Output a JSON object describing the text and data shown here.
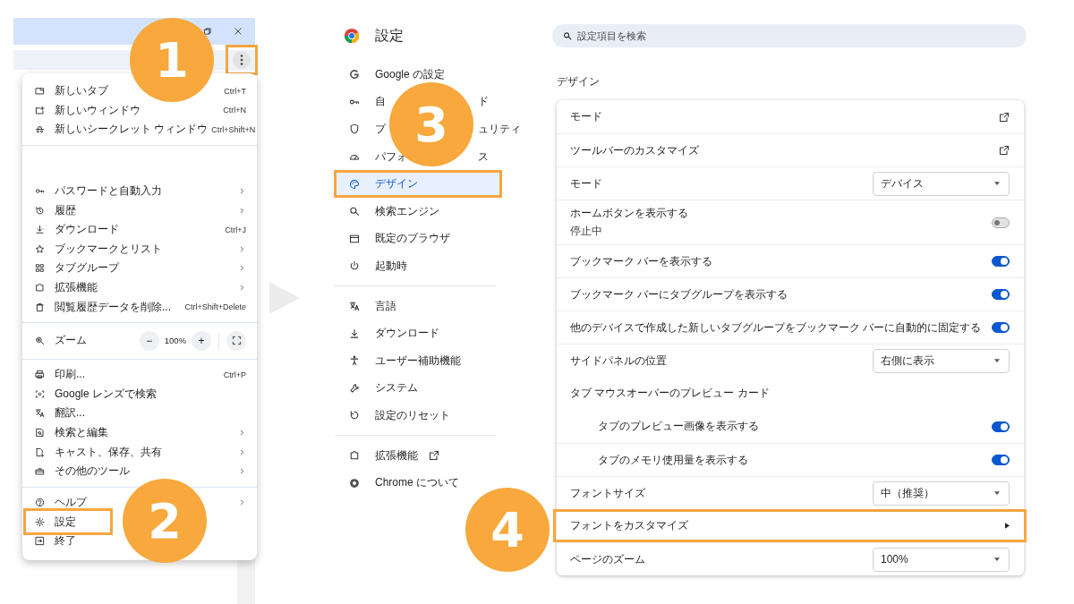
{
  "browser_menu": {
    "items": [
      {
        "kind": "item",
        "label": "新しいタブ",
        "shortcut": "Ctrl+T",
        "highlighted": false
      },
      {
        "kind": "item",
        "label": "新しいウィンドウ",
        "shortcut": "Ctrl+N",
        "highlighted": false
      },
      {
        "kind": "item",
        "label": "新しいシークレット ウィンドウ",
        "shortcut": "Ctrl+Shift+N",
        "highlighted": false
      },
      {
        "kind": "divider"
      },
      {
        "kind": "blank"
      },
      {
        "kind": "item",
        "label": "パスワードと自動入力",
        "submenu": true,
        "highlighted": false
      },
      {
        "kind": "item",
        "label": "履歴",
        "submenu": true,
        "highlighted": false
      },
      {
        "kind": "item",
        "label": "ダウンロード",
        "shortcut": "Ctrl+J",
        "highlighted": false
      },
      {
        "kind": "item",
        "label": "ブックマークとリスト",
        "submenu": true,
        "highlighted": false
      },
      {
        "kind": "item",
        "label": "タブグループ",
        "submenu": true,
        "highlighted": false
      },
      {
        "kind": "item",
        "label": "拡張機能",
        "submenu": true,
        "highlighted": false
      },
      {
        "kind": "item",
        "label": "閲覧履歴データを削除...",
        "shortcut": "Ctrl+Shift+Delete",
        "highlighted": false
      },
      {
        "kind": "divider"
      },
      {
        "kind": "zoom",
        "label": "ズーム",
        "minus": "−",
        "value": "100%",
        "plus": "+"
      },
      {
        "kind": "divider"
      },
      {
        "kind": "item",
        "label": "印刷...",
        "shortcut": "Ctrl+P",
        "highlighted": false
      },
      {
        "kind": "item",
        "label": "Google レンズで検索",
        "submenu": false,
        "highlighted": false
      },
      {
        "kind": "item",
        "label": "翻訳...",
        "submenu": false,
        "highlighted": false
      },
      {
        "kind": "item",
        "label": "検索と編集",
        "submenu": true,
        "highlighted": false
      },
      {
        "kind": "item",
        "label": "キャスト、保存、共有",
        "submenu": true,
        "highlighted": false
      },
      {
        "kind": "item",
        "label": "その他のツール",
        "submenu": true,
        "highlighted": false
      },
      {
        "kind": "divider"
      },
      {
        "kind": "item",
        "label": "ヘルプ",
        "submenu": true,
        "highlighted": false
      },
      {
        "kind": "item",
        "label": "設定",
        "submenu": false,
        "highlighted": true
      },
      {
        "kind": "item",
        "label": "終了",
        "submenu": false,
        "highlighted": false
      }
    ],
    "menu_button_highlighted": true
  },
  "settings_sidebar": {
    "title": "設定",
    "items": [
      {
        "kind": "item",
        "label": "Google の設定",
        "selected": false,
        "highlighted": false
      },
      {
        "kind": "item",
        "label": "自",
        "label_end": "ド",
        "selected": false,
        "highlighted": false
      },
      {
        "kind": "item",
        "label": "プ",
        "label_end": "ュリティ",
        "selected": false,
        "highlighted": false
      },
      {
        "kind": "item",
        "label": "パフォ",
        "label_end": "ス",
        "selected": false,
        "highlighted": false
      },
      {
        "kind": "item",
        "label": "デザイン",
        "selected": true,
        "highlighted": true
      },
      {
        "kind": "item",
        "label": "検索エンジン",
        "selected": false,
        "highlighted": false
      },
      {
        "kind": "item",
        "label": "既定のブラウザ",
        "selected": false,
        "highlighted": false
      },
      {
        "kind": "item",
        "label": "起動時",
        "selected": false,
        "highlighted": false
      },
      {
        "kind": "divider"
      },
      {
        "kind": "item",
        "label": "言語",
        "selected": false,
        "highlighted": false
      },
      {
        "kind": "item",
        "label": "ダウンロード",
        "selected": false,
        "highlighted": false
      },
      {
        "kind": "item",
        "label": "ユーザー補助機能",
        "selected": false,
        "highlighted": false
      },
      {
        "kind": "item",
        "label": "システム",
        "selected": false,
        "highlighted": false
      },
      {
        "kind": "item",
        "label": "設定のリセット",
        "selected": false,
        "highlighted": false
      },
      {
        "kind": "divider"
      },
      {
        "kind": "item",
        "label": "拡張機能",
        "external": true,
        "selected": false,
        "highlighted": false
      },
      {
        "kind": "item",
        "label": "Chrome について",
        "selected": false,
        "highlighted": false
      }
    ]
  },
  "settings_main": {
    "search": {
      "placeholder": "設定項目を検索"
    },
    "section_title": "デザイン",
    "rows": [
      {
        "kind": "link",
        "label": "モード",
        "highlighted": false
      },
      {
        "kind": "link",
        "label": "ツールバーのカスタマイズ",
        "highlighted": false
      },
      {
        "kind": "select",
        "label": "モード",
        "value": "デバイス",
        "highlighted": false
      },
      {
        "kind": "toggle",
        "label": "ホームボタンを表示する",
        "sublabel": "停止中",
        "on": false,
        "highlighted": false
      },
      {
        "kind": "toggle",
        "label": "ブックマーク バーを表示する",
        "on": true,
        "highlighted": false
      },
      {
        "kind": "toggle",
        "label": "ブックマーク バーにタブグループを表示する",
        "on": true,
        "highlighted": false
      },
      {
        "kind": "toggle",
        "label": "他のデバイスで作成した新しいタブグループをブックマーク バーに自動的に固定する",
        "on": true,
        "highlighted": false
      },
      {
        "kind": "select",
        "label": "サイドパネルの位置",
        "value": "右側に表示",
        "highlighted": false
      },
      {
        "kind": "heading",
        "label": "タブ マウスオーバーのプレビュー カード",
        "highlighted": false,
        "children": [
          {
            "kind": "toggle",
            "label": "タブのプレビュー画像を表示する",
            "on": true,
            "highlighted": false
          },
          {
            "kind": "toggle",
            "label": "タブのメモリ使用量を表示する",
            "on": true,
            "highlighted": false
          }
        ]
      },
      {
        "kind": "select",
        "label": "フォントサイズ",
        "value": "中（推奨）",
        "highlighted": false
      },
      {
        "kind": "arrow",
        "label": "フォントをカスタマイズ",
        "highlighted": true
      },
      {
        "kind": "select",
        "label": "ページのズーム",
        "value": "100%",
        "highlighted": false
      }
    ]
  },
  "steps": [
    {
      "label": "1"
    },
    {
      "label": "2"
    },
    {
      "label": "3"
    },
    {
      "label": "4"
    }
  ]
}
